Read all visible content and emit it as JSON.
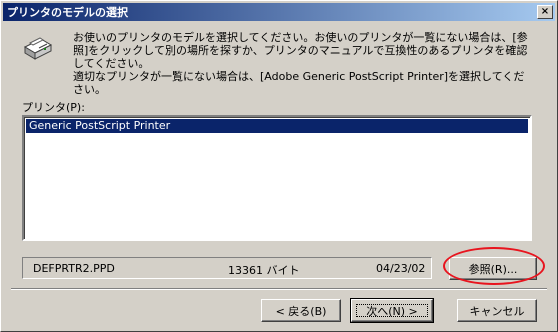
{
  "window": {
    "title": "プリンタのモデルの選択",
    "close_glyph": "×"
  },
  "message": {
    "line1": "お使いのプリンタのモデルを選択してください。お使いのプリンタが一覧にない場合は、[参照]をクリックして別の場所を探すか、プリンタのマニュアルで互換性のあるプリンタを確認してください。",
    "line2": "適切なプリンタが一覧にない場合は、[Adobe Generic PostScript Printer]を選択してください。"
  },
  "printer_list": {
    "label": "プリンタ(P):",
    "items": [
      "Generic PostScript Printer"
    ],
    "selected_index": 0
  },
  "file_info": {
    "filename": "DEFPRTR2.PPD",
    "size": "13361 バイト",
    "date": "04/23/02"
  },
  "buttons": {
    "browse": "参照(R)...",
    "back": "< 戻る(B)",
    "next": "次へ(N) >",
    "cancel": "キャンセル"
  },
  "colors": {
    "highlight": "#e8141e",
    "selection": "#0a246a",
    "titlebar": "#0a246a"
  },
  "icons": [
    "printer-icon",
    "close-icon"
  ]
}
